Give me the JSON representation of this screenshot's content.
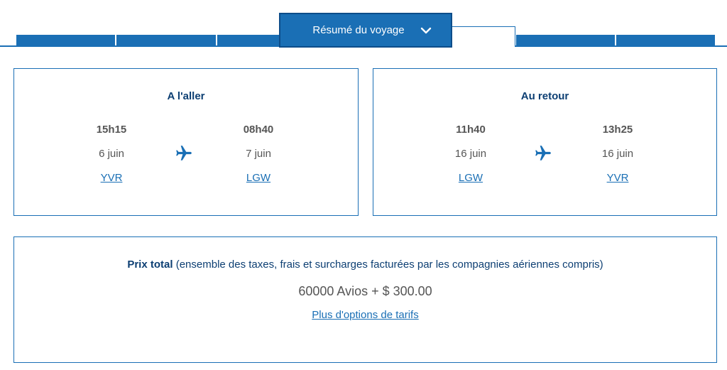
{
  "tabs": {
    "active_label": "Résumé du voyage"
  },
  "outbound": {
    "title": "A l'aller",
    "depart_time": "15h15",
    "depart_date": "6 juin",
    "depart_airport": "YVR",
    "arrive_time": "08h40",
    "arrive_date": "7 juin",
    "arrive_airport": "LGW"
  },
  "return": {
    "title": "Au retour",
    "depart_time": "11h40",
    "depart_date": "16 juin",
    "depart_airport": "LGW",
    "arrive_time": "13h25",
    "arrive_date": "16 juin",
    "arrive_airport": "YVR"
  },
  "price": {
    "label": "Prix total",
    "detail": "(ensemble des taxes, frais et surcharges facturées par les compagnies aériennes compris)",
    "amount": "60000 Avios + $ 300.00",
    "more_options": "Plus d'options de tarifs"
  },
  "colors": {
    "accent": "#1a6fb5",
    "heading": "#0d3f73"
  },
  "icons": {
    "tab_chevron": "chevron-down-icon",
    "flight": "airplane-icon"
  }
}
